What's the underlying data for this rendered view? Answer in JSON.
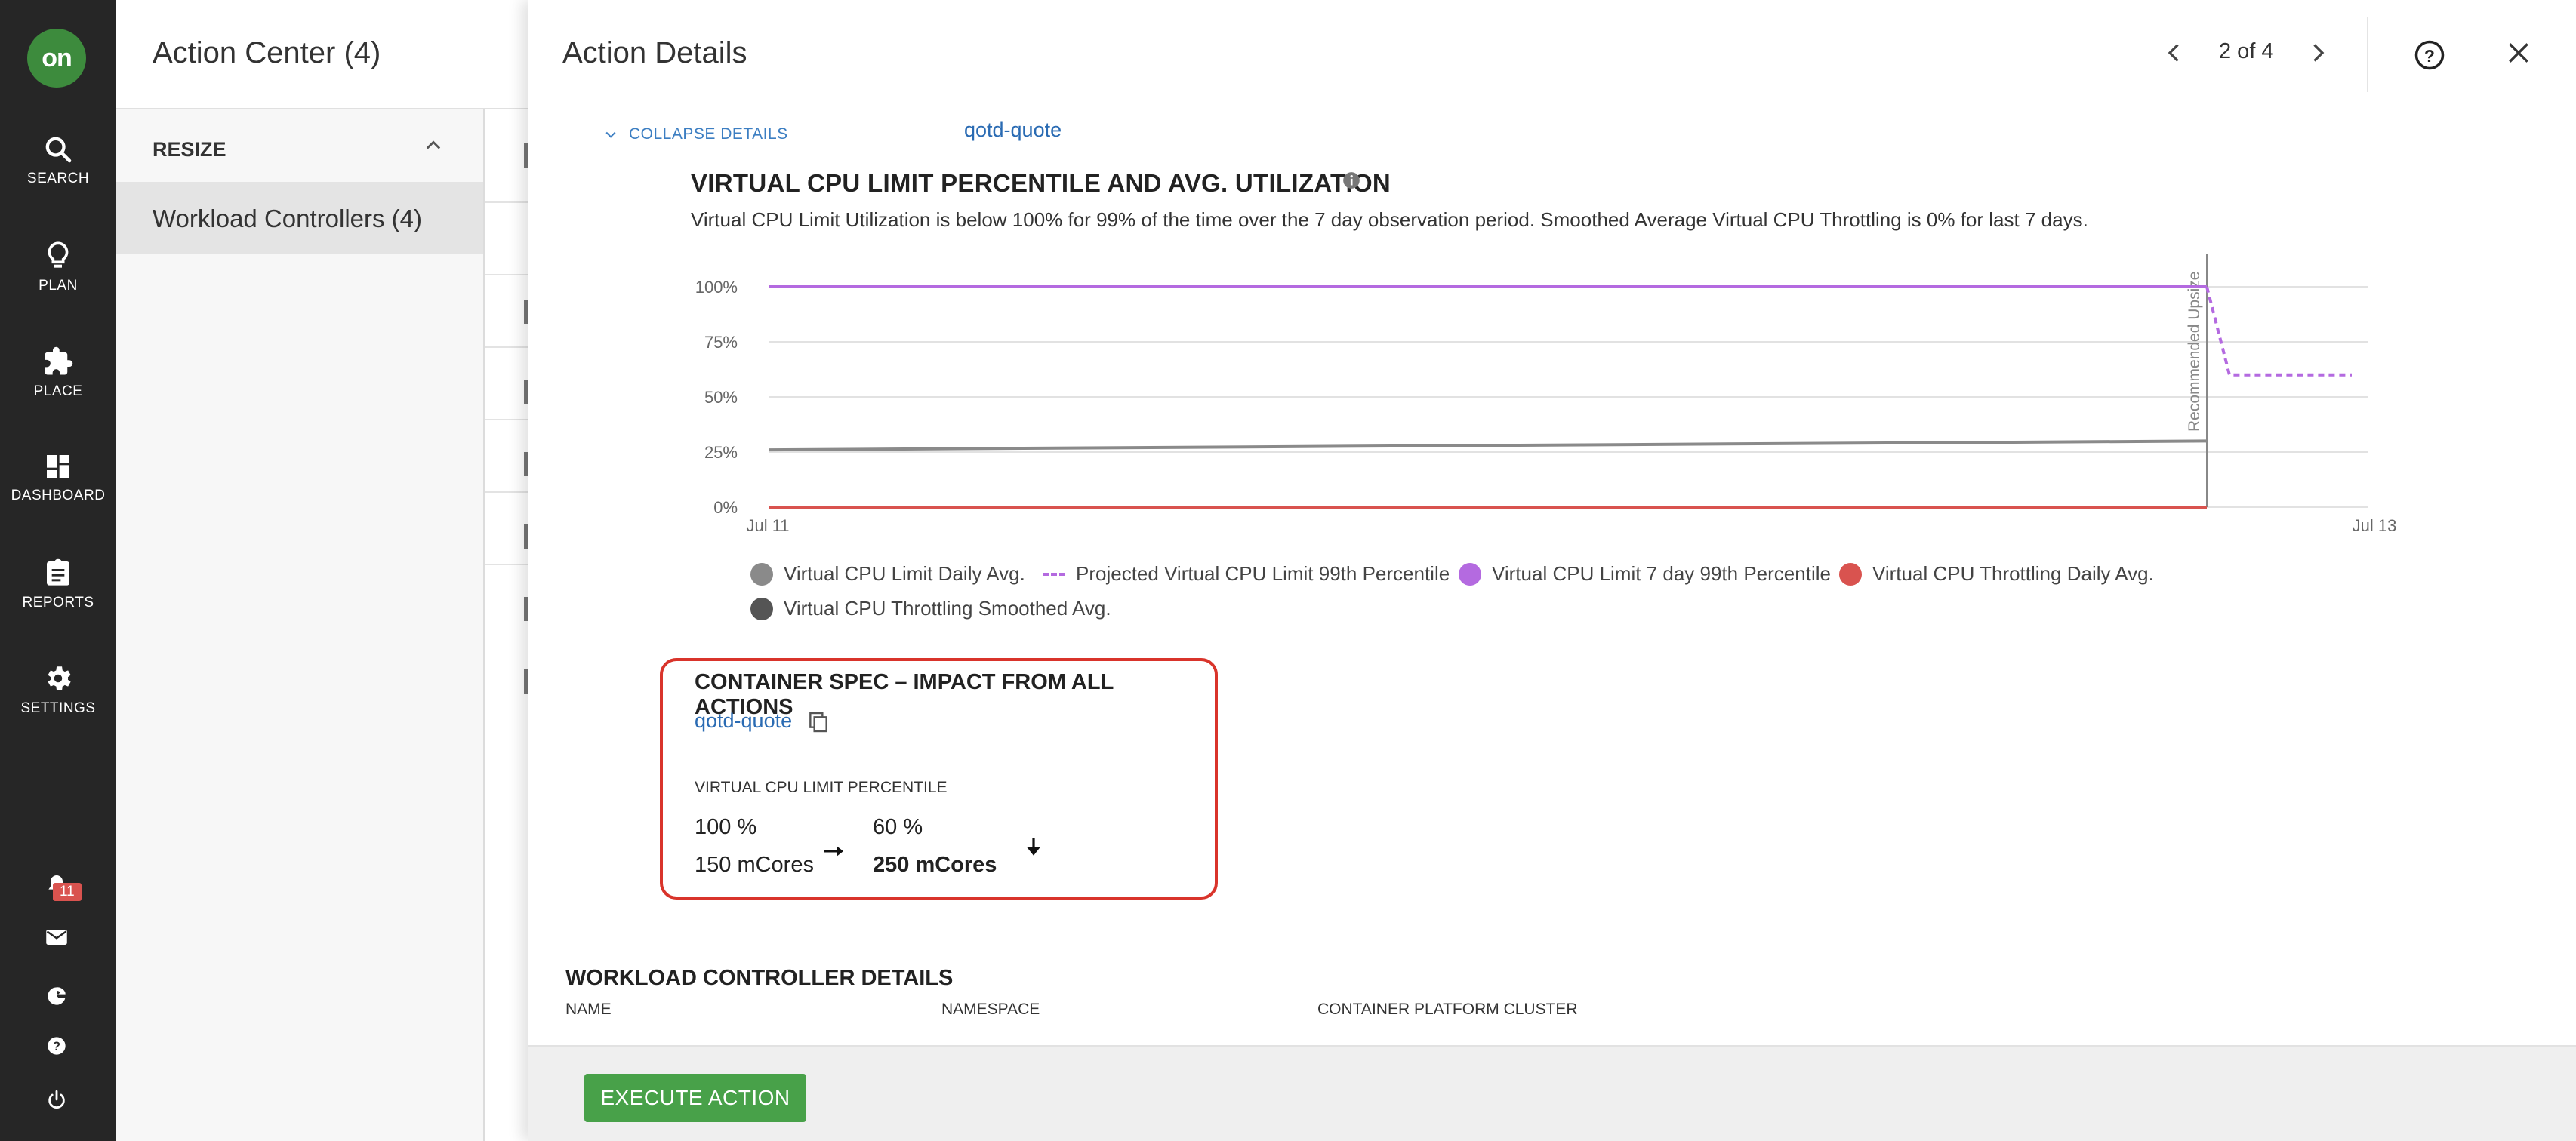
{
  "app": {
    "logo_text": "on",
    "brand_color": "#3d8b3d"
  },
  "leftnav": {
    "items": [
      {
        "label": "SEARCH",
        "icon": "search-icon"
      },
      {
        "label": "PLAN",
        "icon": "lightbulb-icon"
      },
      {
        "label": "PLACE",
        "icon": "puzzle-icon"
      },
      {
        "label": "DASHBOARD",
        "icon": "dashboard-icon"
      },
      {
        "label": "REPORTS",
        "icon": "clipboard-icon"
      },
      {
        "label": "SETTINGS",
        "icon": "gear-icon"
      }
    ],
    "footer_icons": [
      "notification-icon",
      "mail-icon",
      "google-icon",
      "help-icon",
      "power-icon"
    ],
    "notification_count": "11"
  },
  "action_center": {
    "title": "Action Center (4)",
    "group_label": "RESIZE",
    "selected_item": "Workload Controllers (4)"
  },
  "panel": {
    "title": "Action Details",
    "pager": "2 of 4",
    "collapse_label": "COLLAPSE DETAILS",
    "entity_link": "qotd-quote"
  },
  "chart": {
    "title": "VIRTUAL CPU LIMIT PERCENTILE AND AVG. UTILIZATION",
    "description": "Virtual CPU Limit Utilization is below 100% for 99% of the time over the 7 day observation period. Smoothed Average Virtual CPU Throttling is 0% for last 7 days.",
    "annotation": "Recommended Upsize"
  },
  "chart_data": {
    "type": "line",
    "x_ticks": [
      "Jul 11",
      "Jul 13"
    ],
    "y_ticks": [
      "100%",
      "75%",
      "50%",
      "25%",
      "0%"
    ],
    "ylim": [
      0,
      100
    ],
    "grid": true,
    "legend_position": "bottom",
    "series": [
      {
        "name": "Virtual CPU Limit Daily Avg.",
        "color": "#8a8a8a",
        "values": [
          26,
          30
        ]
      },
      {
        "name": "Projected Virtual CPU Limit 99th Percentile",
        "color": "#b46ae0",
        "style": "dashed",
        "values": [
          100,
          60,
          60
        ]
      },
      {
        "name": "Virtual CPU Limit 7 day 99th Percentile",
        "color": "#b46ae0",
        "values": [
          100,
          100
        ]
      },
      {
        "name": "Virtual CPU Throttling Daily Avg.",
        "color": "#d9534f",
        "values": [
          0,
          0
        ]
      },
      {
        "name": "Virtual CPU Throttling Smoothed Avg.",
        "color": "#555555",
        "values": [
          0,
          0
        ]
      }
    ]
  },
  "container_spec": {
    "title": "CONTAINER SPEC – IMPACT FROM ALL ACTIONS",
    "link": "qotd-quote",
    "metric_label": "VIRTUAL CPU LIMIT PERCENTILE",
    "from_percent": "100 %",
    "from_value": "150 mCores",
    "to_percent": "60 %",
    "to_value": "250 mCores"
  },
  "workload_details": {
    "title": "WORKLOAD CONTROLLER DETAILS",
    "columns": [
      "NAME",
      "NAMESPACE",
      "CONTAINER PLATFORM CLUSTER"
    ]
  },
  "footer": {
    "execute_label": "EXECUTE ACTION",
    "execute_color": "#48a149"
  }
}
